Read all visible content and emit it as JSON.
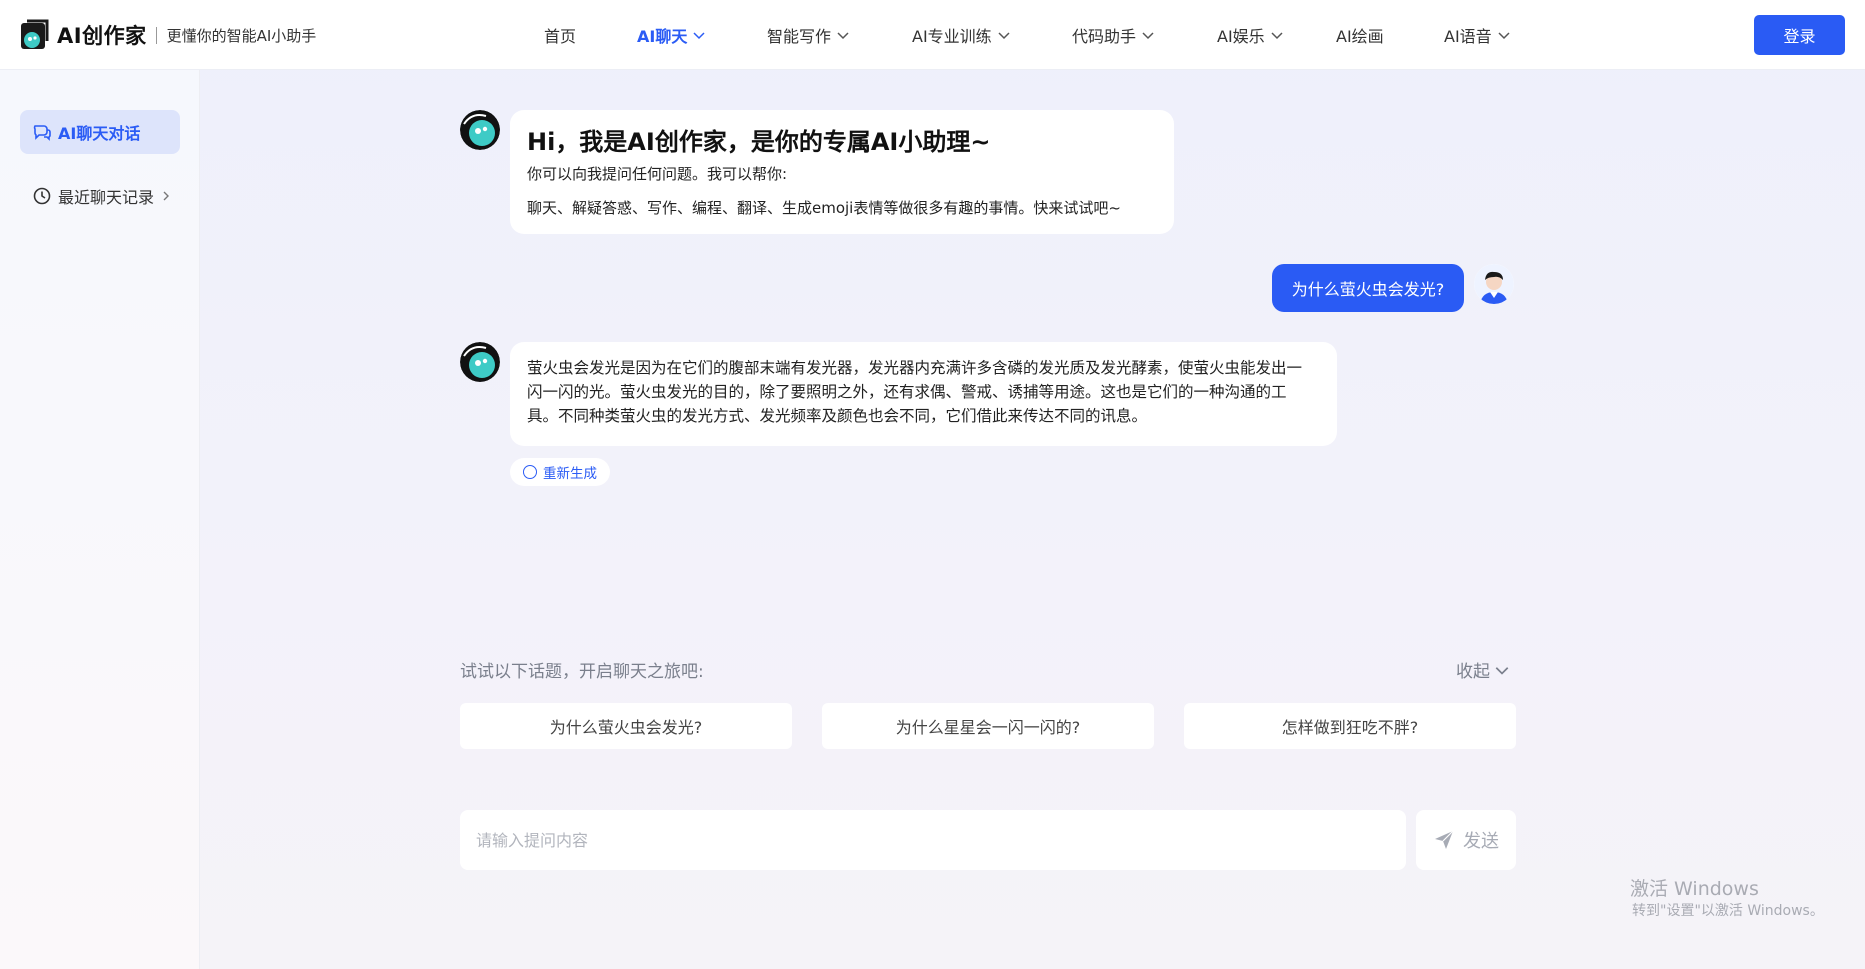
{
  "header": {
    "brand": "AI创作家",
    "slogan": "更懂你的智能AI小助手",
    "nav": [
      {
        "label": "首页",
        "active": false,
        "dropdown": false
      },
      {
        "label": "AI聊天",
        "active": true,
        "dropdown": true
      },
      {
        "label": "智能写作",
        "active": false,
        "dropdown": true
      },
      {
        "label": "AI专业训练",
        "active": false,
        "dropdown": true
      },
      {
        "label": "代码助手",
        "active": false,
        "dropdown": true
      },
      {
        "label": "AI娱乐",
        "active": false,
        "dropdown": true
      },
      {
        "label": "AI绘画",
        "active": false,
        "dropdown": false
      },
      {
        "label": "AI语音",
        "active": false,
        "dropdown": true
      }
    ],
    "login_label": "登录"
  },
  "sidebar": {
    "items": [
      {
        "label": "AI聊天对话",
        "icon": "chat-bubbles-icon",
        "active": true
      },
      {
        "label": "最近聊天记录",
        "icon": "clock-icon",
        "active": false
      }
    ]
  },
  "chat": {
    "greeting": {
      "title": "Hi，我是AI创作家，是你的专属AI小助理~",
      "line1": "你可以向我提问任何问题。我可以帮你:",
      "line2": "聊天、解疑答惑、写作、编程、翻译、生成emoji表情等做很多有趣的事情。快来试试吧~"
    },
    "user_message": "为什么萤火虫会发光?",
    "answer": "萤火虫会发光是因为在它们的腹部末端有发光器，发光器内充满许多含磷的发光质及发光酵素，使萤火虫能发出一闪一闪的光。萤火虫发光的目的，除了要照明之外，还有求偶、警戒、诱捕等用途。这也是它们的一种沟通的工具。不同种类萤火虫的发光方式、发光频率及颜色也会不同，它们借此来传达不同的讯息。",
    "regenerate_label": "重新生成"
  },
  "topics": {
    "title": "试试以下话题，开启聊天之旅吧:",
    "collapse_label": "收起",
    "items": [
      "为什么萤火虫会发光?",
      "为什么星星会一闪一闪的?",
      "怎样做到狂吃不胖?"
    ]
  },
  "composer": {
    "placeholder": "请输入提问内容",
    "value": "",
    "send_label": "发送"
  },
  "watermark": {
    "line1": "激活 Windows",
    "line2": "转到\"设置\"以激活 Windows。"
  },
  "colors": {
    "accent": "#2a5bf4",
    "bot_teal": "#3ecbc6"
  }
}
